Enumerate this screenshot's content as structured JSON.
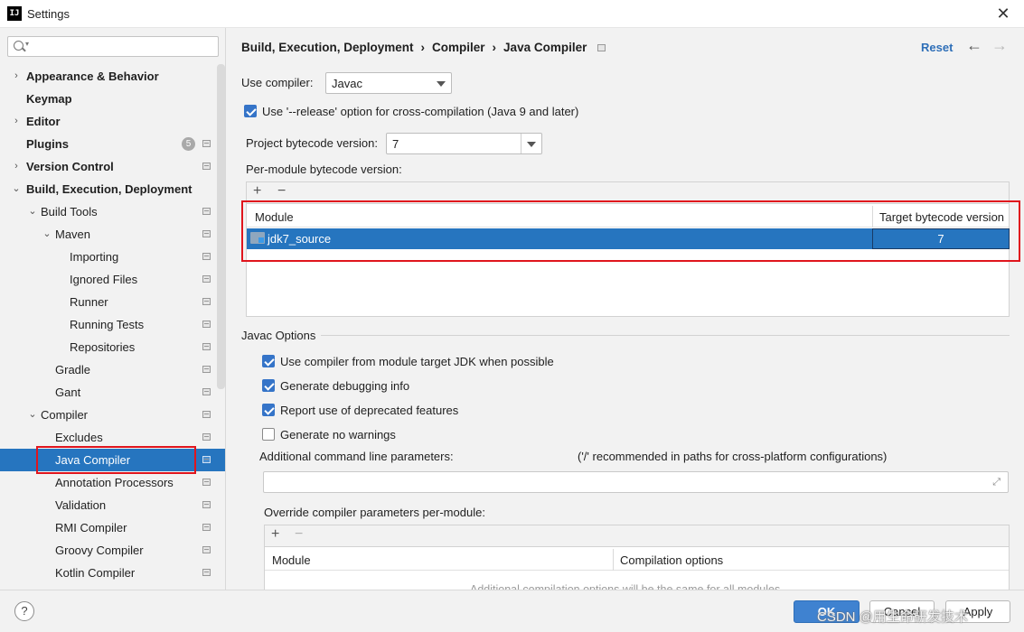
{
  "window": {
    "title": "Settings",
    "app_icon_text": "IJ",
    "close_glyph": "✕"
  },
  "search": {
    "placeholder": ""
  },
  "sidebar": {
    "items": [
      {
        "label": "Appearance & Behavior",
        "bold": true,
        "arrow": "›",
        "level": 0
      },
      {
        "label": "Keymap",
        "bold": true,
        "level": 0
      },
      {
        "label": "Editor",
        "bold": true,
        "arrow": "›",
        "level": 0
      },
      {
        "label": "Plugins",
        "bold": true,
        "level": 0,
        "badge": "5"
      },
      {
        "label": "Version Control",
        "bold": true,
        "arrow": "›",
        "level": 0
      },
      {
        "label": "Build, Execution, Deployment",
        "bold": true,
        "arrow": "⌄",
        "level": 0
      },
      {
        "label": "Build Tools",
        "arrow": "⌄",
        "level": 1
      },
      {
        "label": "Maven",
        "arrow": "⌄",
        "level": 2
      },
      {
        "label": "Importing",
        "level": 3
      },
      {
        "label": "Ignored Files",
        "level": 3
      },
      {
        "label": "Runner",
        "level": 3
      },
      {
        "label": "Running Tests",
        "level": 3
      },
      {
        "label": "Repositories",
        "level": 3
      },
      {
        "label": "Gradle",
        "level": 2
      },
      {
        "label": "Gant",
        "level": 2
      },
      {
        "label": "Compiler",
        "arrow": "⌄",
        "level": 1
      },
      {
        "label": "Excludes",
        "level": 2
      },
      {
        "label": "Java Compiler",
        "level": 2,
        "selected": true
      },
      {
        "label": "Annotation Processors",
        "level": 2
      },
      {
        "label": "Validation",
        "level": 2
      },
      {
        "label": "RMI Compiler",
        "level": 2
      },
      {
        "label": "Groovy Compiler",
        "level": 2
      },
      {
        "label": "Kotlin Compiler",
        "level": 2
      }
    ]
  },
  "header": {
    "breadcrumb": [
      "Build, Execution, Deployment",
      "Compiler",
      "Java Compiler"
    ],
    "separator": "›",
    "reset": "Reset",
    "back_glyph": "←",
    "forward_glyph": "→"
  },
  "compiler": {
    "use_compiler_label": "Use compiler:",
    "use_compiler_value": "Javac",
    "release_option_label": "Use '--release' option for cross-compilation (Java 9 and later)",
    "release_option_checked": true,
    "project_bytecode_label": "Project bytecode version:",
    "project_bytecode_value": "7",
    "per_module_label": "Per-module bytecode version:"
  },
  "module_table": {
    "add_glyph": "+",
    "remove_glyph": "−",
    "columns": [
      "Module",
      "Target bytecode version"
    ],
    "rows": [
      {
        "module": "jdk7_source",
        "target": "7"
      }
    ]
  },
  "javac": {
    "section_title": "Javac Options",
    "options": [
      {
        "label": "Use compiler from module target JDK when possible",
        "checked": true
      },
      {
        "label": "Generate debugging info",
        "checked": true
      },
      {
        "label": "Report use of deprecated features",
        "checked": true
      },
      {
        "label": "Generate no warnings",
        "checked": false
      }
    ],
    "additional_params_label": "Additional command line parameters:",
    "additional_params_hint": "('/' recommended in paths for cross-platform configurations)",
    "additional_params_value": "",
    "expand_glyph": "⤢",
    "override_label": "Override compiler parameters per-module:",
    "override_columns": [
      "Module",
      "Compilation options"
    ],
    "override_empty_text": "Additional compilation options will be the same for all modules"
  },
  "footer": {
    "help": "?",
    "ok": "OK",
    "cancel": "Cancel",
    "apply": "Apply",
    "watermark": "CSDN @用生命研发技术"
  },
  "colors": {
    "selection": "#2675bf",
    "accent_link": "#2f6fb8",
    "highlight_border": "#e0151d"
  }
}
